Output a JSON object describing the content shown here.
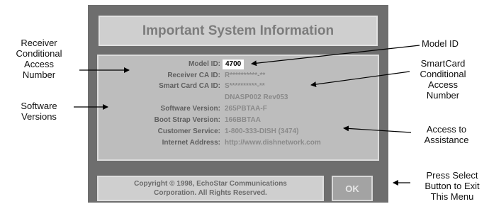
{
  "screen": {
    "title": "Important System Information",
    "model_id_label": "Model ID:",
    "model_id_value": "4700",
    "receiver_ca_label": "Receiver CA ID:",
    "receiver_ca_value": "R**********-**",
    "smart_card_label": "Smart Card CA ID:",
    "smart_card_value": "S**********-**",
    "smart_card_value2": "DNASP002 Rev053",
    "software_label": "Software Version:",
    "software_value": "265PBTAA-F",
    "boot_label": "Boot Strap Version:",
    "boot_value": "166BBTAA",
    "customer_label": "Customer Service:",
    "customer_value": "1-800-333-DISH (3474)",
    "internet_label": "Internet Address:",
    "internet_value": "http://www.dishnetwork.com",
    "copyright_line1": "Copyright © 1998, EchoStar Communications",
    "copyright_line2": "Corporation. All Rights Reserved.",
    "ok_label": "OK"
  },
  "callouts": {
    "receiver": [
      "Receiver",
      "Conditional",
      "Access",
      "Number"
    ],
    "software": [
      "Software",
      "Versions"
    ],
    "model": "Model ID",
    "smartcard": [
      "SmartCard",
      "Conditional",
      "Access",
      "Number"
    ],
    "assistance": [
      "Access to",
      "Assistance"
    ],
    "press_select": [
      "Press Select",
      "Button to Exit",
      "This Menu"
    ]
  }
}
